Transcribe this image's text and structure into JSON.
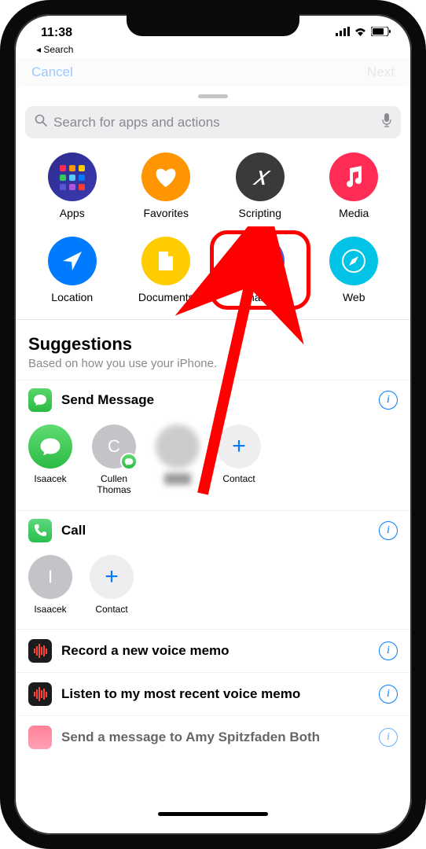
{
  "status": {
    "time": "11:38",
    "back": "Search"
  },
  "dimmed": {
    "left": "Cancel",
    "right": "Next"
  },
  "search": {
    "placeholder": "Search for apps and actions"
  },
  "categories": [
    {
      "id": "apps",
      "label": "Apps"
    },
    {
      "id": "favorites",
      "label": "Favorites"
    },
    {
      "id": "scripting",
      "label": "Scripting"
    },
    {
      "id": "media",
      "label": "Media"
    },
    {
      "id": "location",
      "label": "Location"
    },
    {
      "id": "documents",
      "label": "Documents"
    },
    {
      "id": "sharing",
      "label": "Sharing"
    },
    {
      "id": "web",
      "label": "Web"
    }
  ],
  "suggestions": {
    "title": "Suggestions",
    "subtitle": "Based on how you use your iPhone."
  },
  "sendMessage": {
    "title": "Send Message",
    "contacts": [
      {
        "name": "Isaacek",
        "type": "green"
      },
      {
        "name": "Cullen Thomas",
        "initial": "C",
        "type": "gray"
      },
      {
        "name": "",
        "type": "blur"
      },
      {
        "name": "Contact",
        "type": "plus"
      }
    ]
  },
  "call": {
    "title": "Call",
    "contacts": [
      {
        "name": "Isaacek",
        "initial": "I",
        "type": "gray"
      },
      {
        "name": "Contact",
        "type": "plus"
      }
    ]
  },
  "voiceMemos": [
    {
      "label": "Record a new voice memo"
    },
    {
      "label": "Listen to my most recent voice memo"
    }
  ],
  "cutoff": {
    "label": "Send a message to Amy Spitzfaden Both"
  }
}
